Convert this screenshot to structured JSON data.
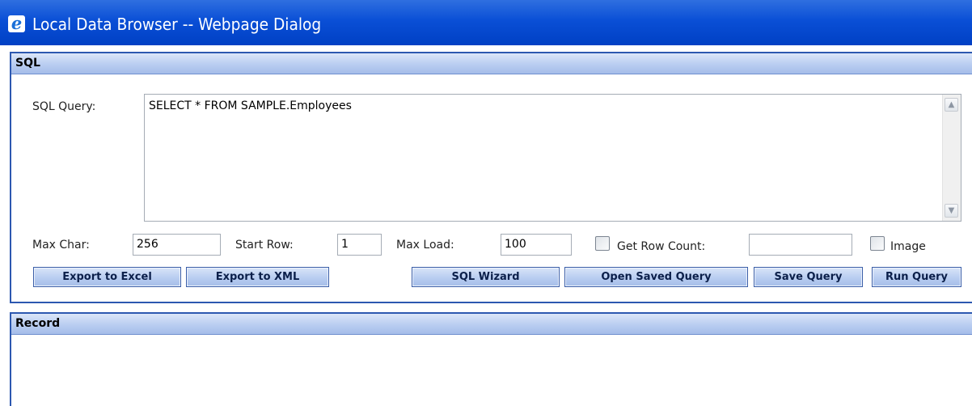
{
  "window": {
    "title": "Local Data Browser -- Webpage Dialog",
    "icon": "ie-icon"
  },
  "sql_panel": {
    "header": "SQL",
    "query_label": "SQL Query:",
    "query_value": "SELECT * FROM SAMPLE.Employees",
    "max_char": {
      "label": "Max Char:",
      "value": "256"
    },
    "start_row": {
      "label": "Start Row:",
      "value": "1"
    },
    "max_load": {
      "label": "Max Load:",
      "value": "100"
    },
    "row_count": {
      "label": "Get Row Count:",
      "checked": false,
      "value": ""
    },
    "image": {
      "label": "Image",
      "checked": false
    },
    "buttons": {
      "export_excel": "Export to Excel",
      "export_xml": "Export to XML",
      "sql_wizard": "SQL Wizard",
      "open_saved": "Open Saved Query",
      "save_query": "Save Query",
      "run_query": "Run Query"
    }
  },
  "record_panel": {
    "header": "Record"
  },
  "colors": {
    "titlebar": "#0a4fd6",
    "panel_border": "#2c58b0",
    "button_fill": "#b6cbf0"
  }
}
